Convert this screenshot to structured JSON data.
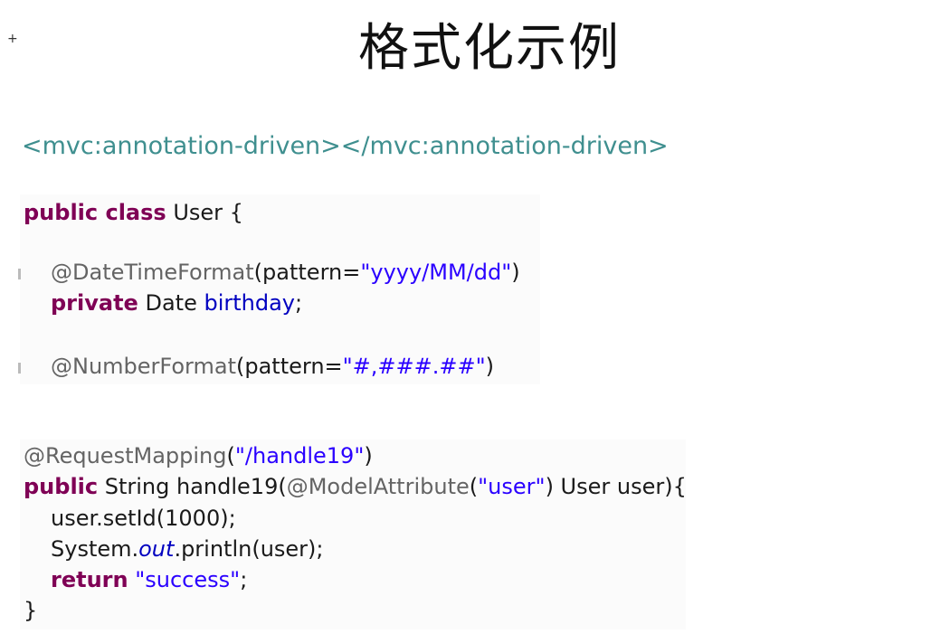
{
  "slide": {
    "title": "格式化示例",
    "crosshair": "+"
  },
  "xml": {
    "line": "<mvc:annotation-driven></mvc:annotation-driven>"
  },
  "user_class": {
    "l1_kw": "public class",
    "l1_rest": " User {",
    "l2_ann": "@DateTimeFormat",
    "l2_open": "(pattern=",
    "l2_str": "\"yyyy/MM/dd\"",
    "l2_close": ")",
    "l3_kw": "private",
    "l3_type": " Date ",
    "l3_field": "birthday",
    "l3_end": ";",
    "l4_ann": "@NumberFormat",
    "l4_open": "(pattern=",
    "l4_str": "\"#,###.##\"",
    "l4_close": ")"
  },
  "handler": {
    "l1_ann": "@RequestMapping",
    "l1_open": "(",
    "l1_str": "\"/handle19\"",
    "l1_close": ")",
    "l2_kw": "public",
    "l2_mid": " String handle19(",
    "l2_ann": "@ModelAttribute",
    "l2_open": "(",
    "l2_str": "\"user\"",
    "l2_close": ") User user){",
    "l3": "user.setId(1000);",
    "l4_a": "System.",
    "l4_out": "out",
    "l4_b": ".println(user);",
    "l5_kw": "return",
    "l5_sp": " ",
    "l5_str": "\"success\"",
    "l5_end": ";",
    "l6": "}"
  }
}
